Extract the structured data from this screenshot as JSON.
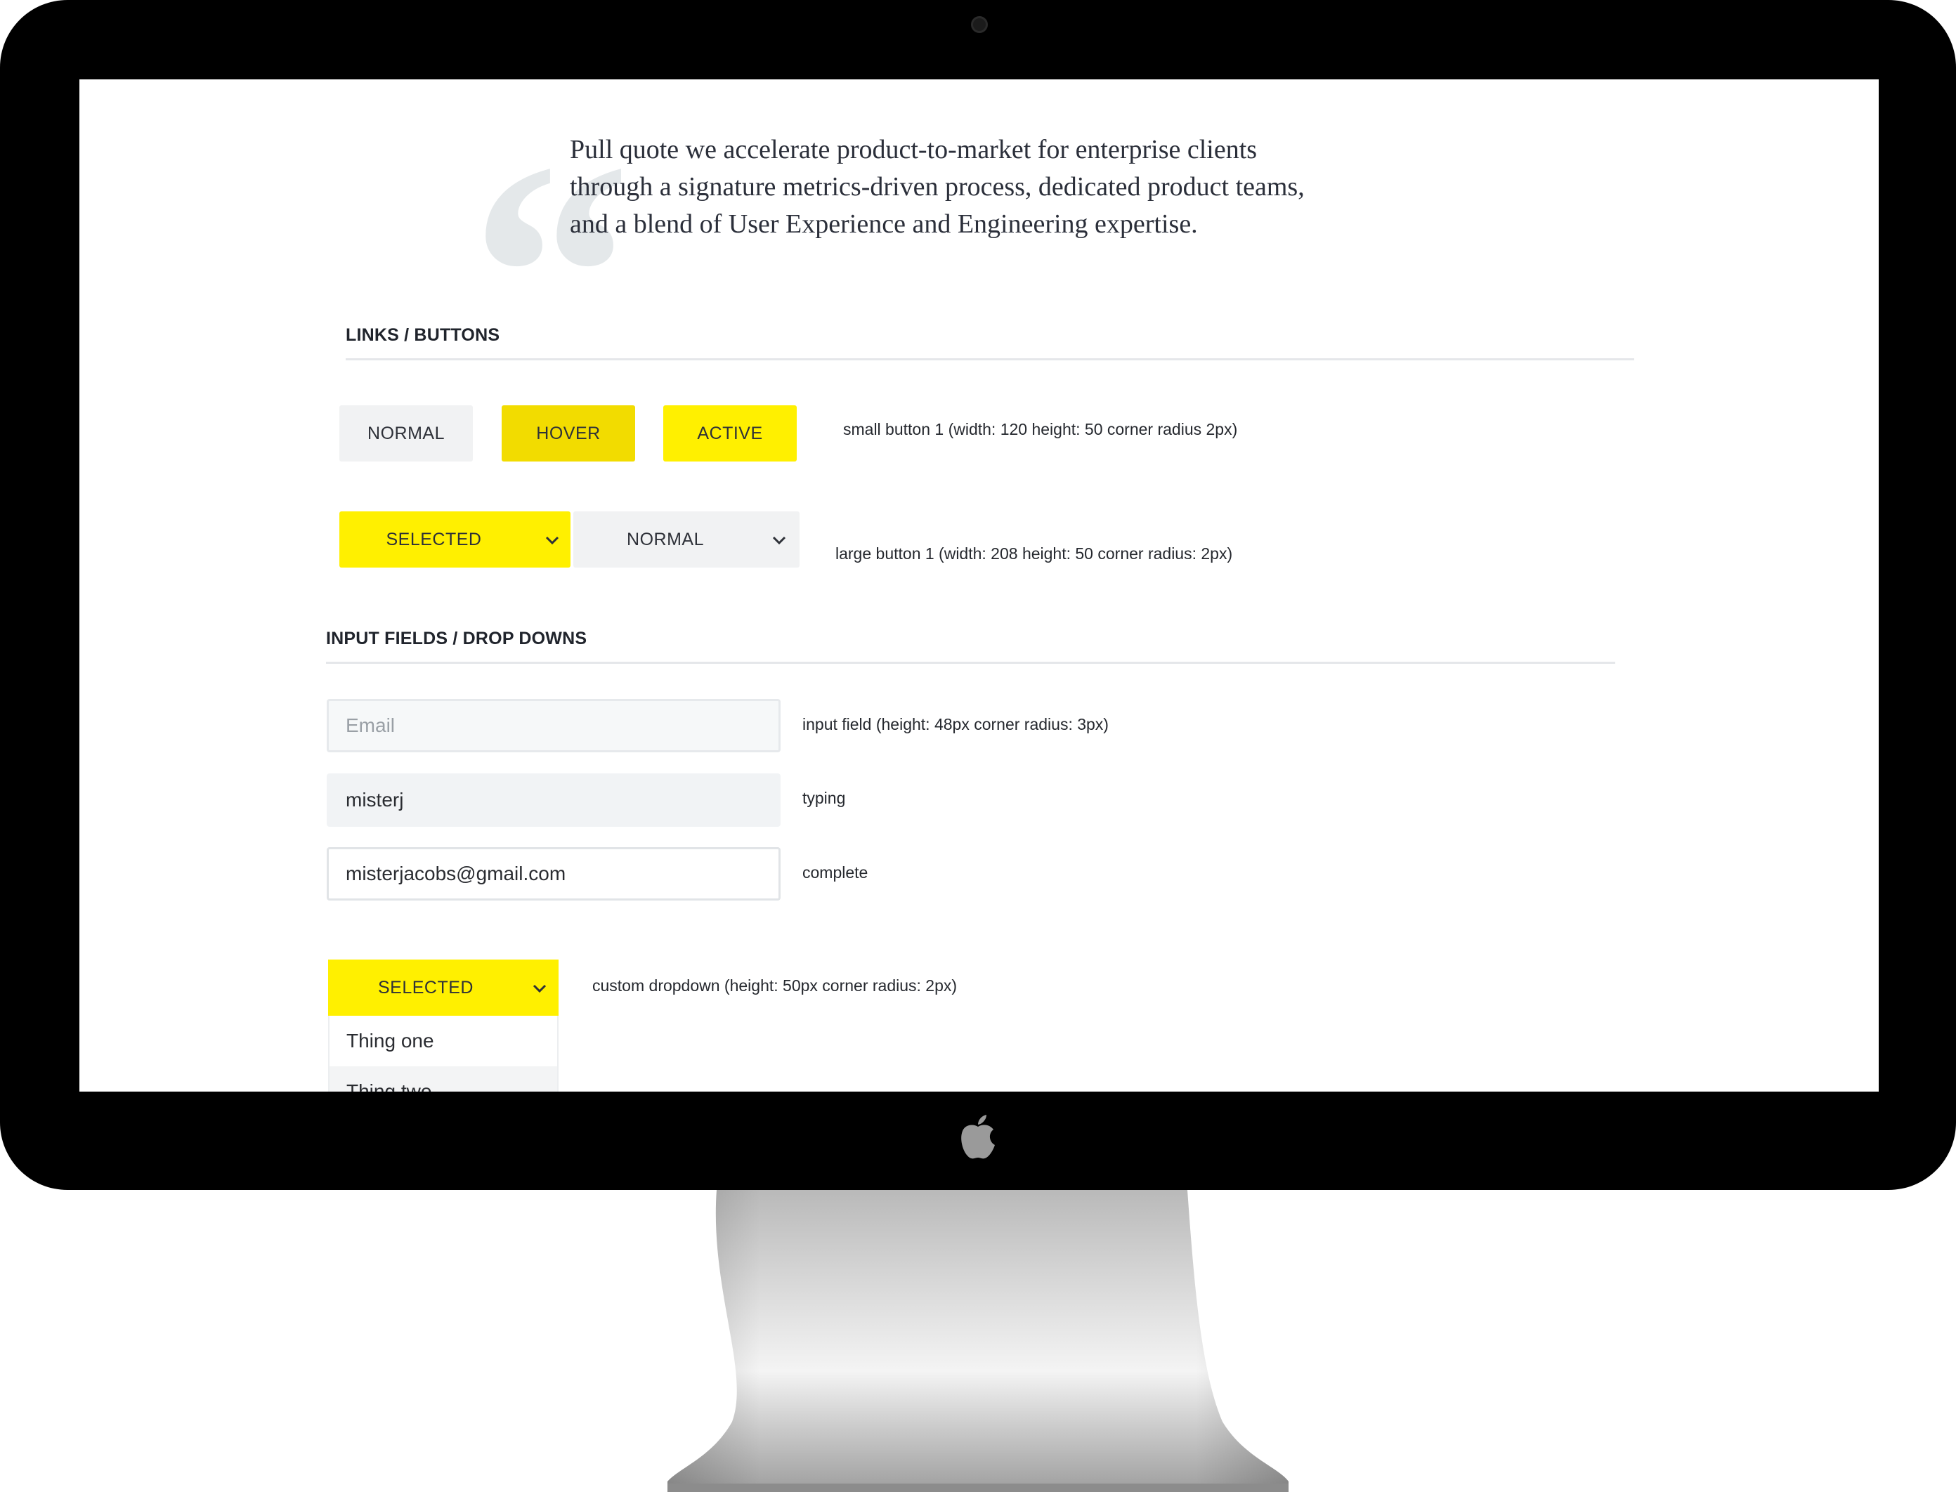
{
  "pull_quote": {
    "mark": "“",
    "lines": [
      "Pull quote we accelerate product-to-market for enterprise clients",
      "through a signature metrics-driven process, dedicated product teams,",
      "and a blend of User Experience and Engineering expertise."
    ]
  },
  "links_buttons": {
    "title": "LINKS / BUTTONS",
    "small_buttons": {
      "normal": "NORMAL",
      "hover": "HOVER",
      "active": "ACTIVE",
      "note": "small button 1 (width: 120 height: 50  corner radius 2px)"
    },
    "large_buttons": {
      "selected": "SELECTED",
      "normal": "NORMAL",
      "note": "large button 1 (width: 208 height: 50  corner radius: 2px)"
    }
  },
  "inputs": {
    "title": "INPUT FIELDS / DROP DOWNS",
    "email": {
      "placeholder": "Email",
      "note": "input field (height: 48px corner radius: 3px)"
    },
    "typing": {
      "value": "misterj",
      "note": "typing"
    },
    "complete": {
      "value": "misterjacobs@gmail.com",
      "note": "complete"
    }
  },
  "dropdown": {
    "selected": "SELECTED",
    "note": "custom dropdown (height: 50px corner radius: 2px)",
    "options": [
      "Thing one",
      "Thing two"
    ]
  },
  "colors": {
    "accent_yellow": "#fff000",
    "hover_yellow": "#f2dc00",
    "neutral_button": "#f1f2f3",
    "bezel": "#000000"
  },
  "icons": [
    "chevron-down-icon",
    "apple-logo-icon",
    "quote-mark-icon"
  ]
}
